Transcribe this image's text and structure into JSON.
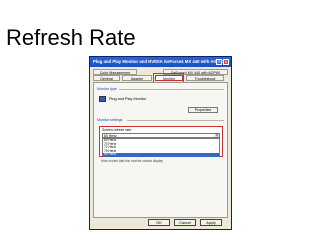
{
  "slide": {
    "title": "Refresh Rate"
  },
  "dialog": {
    "title": "Plug and Play Monitor and NVIDIA GeForce4 MX 440 with AGP8X",
    "help_glyph": "?",
    "close_glyph": "×",
    "tabs_row1": [
      "Color Management",
      "GeForce4 MX 440 with AGP8X"
    ],
    "tabs_row2": [
      "General",
      "Adapter",
      "Monitor",
      "Troubleshoot"
    ],
    "active_tab": "Monitor",
    "monitor_type_label": "Monitor type",
    "monitor_name": "Plug and Play Monitor",
    "properties_button": "Properties",
    "monitor_settings_label": "Monitor settings",
    "refresh_rate_label": "Screen refresh rate:",
    "refresh_rate_value": "85 Hertz",
    "refresh_rate_options": [
      "60 Hertz",
      "70 Hertz",
      "72 Hertz",
      "75 Hertz",
      "85 Hertz"
    ],
    "selected_option_index": 4,
    "hide_modes_text": "Hide modes that this monitor cannot display",
    "buttons": {
      "ok": "OK",
      "cancel": "Cancel",
      "apply": "Apply"
    }
  }
}
